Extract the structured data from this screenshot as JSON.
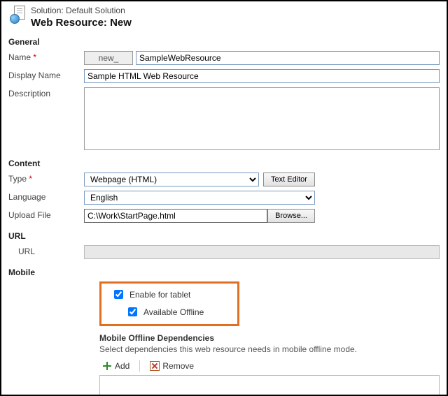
{
  "solution_line": "Solution: Default Solution",
  "title_line": "Web Resource: New",
  "section_general": "General",
  "labels": {
    "name": "Name",
    "display_name": "Display Name",
    "description": "Description",
    "type": "Type",
    "language": "Language",
    "upload_file": "Upload File",
    "url_section": "URL",
    "url_label": "URL",
    "mobile_section": "Mobile",
    "content_section": "Content"
  },
  "values": {
    "name_prefix": "new_",
    "name_value": "SampleWebResource",
    "display_name": "Sample HTML Web Resource",
    "description": "",
    "type_selected": "Webpage (HTML)",
    "language_selected": "English",
    "upload_path": "C:\\Work\\StartPage.html",
    "url": ""
  },
  "buttons": {
    "text_editor": "Text Editor",
    "browse": "Browse..."
  },
  "mobile": {
    "enable_tablet": "Enable for tablet",
    "available_offline": "Available Offline",
    "enable_tablet_checked": true,
    "available_offline_checked": true
  },
  "deps": {
    "title": "Mobile Offline Dependencies",
    "text": "Select dependencies this web resource needs in mobile offline mode.",
    "add": "Add",
    "remove": "Remove"
  }
}
